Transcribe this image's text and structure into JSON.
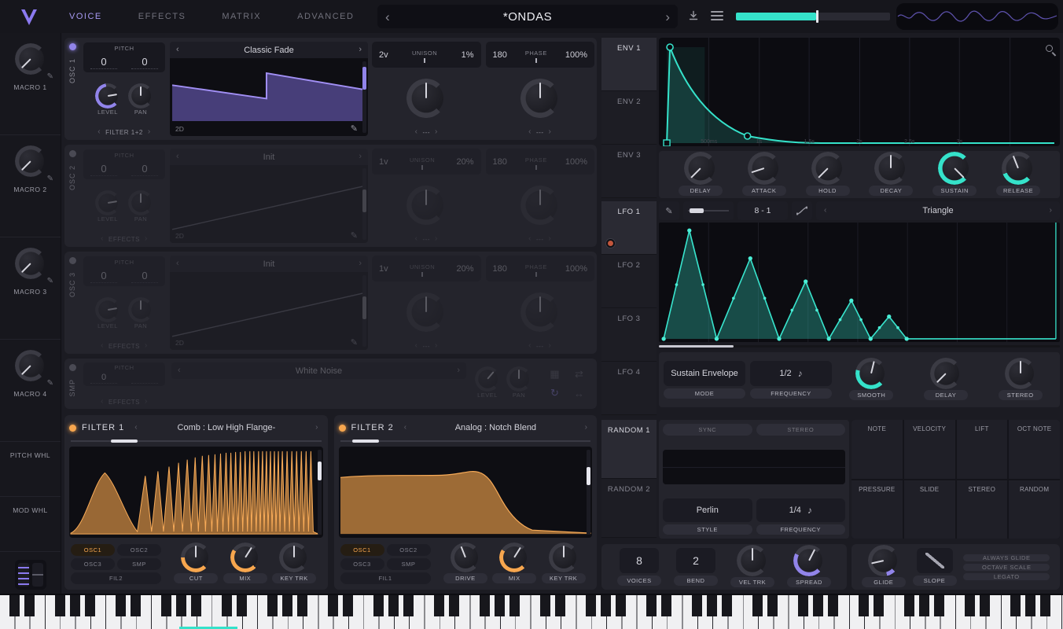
{
  "header": {
    "tabs": [
      "VOICE",
      "EFFECTS",
      "MATRIX",
      "ADVANCED"
    ],
    "preset_name": "*ONDAS"
  },
  "sidebar": {
    "macros": [
      "MACRO 1",
      "MACRO 2",
      "MACRO 3",
      "MACRO 4"
    ],
    "pitch_wheel_label": "PITCH WHL",
    "mod_wheel_label": "MOD WHL"
  },
  "labels": {
    "pitch": "PITCH",
    "level": "LEVEL",
    "pan": "PAN",
    "unison": "UNISON",
    "phase": "PHASE",
    "view_2d": "2D",
    "none_dest": "---"
  },
  "osc1": {
    "name": "OSC 1",
    "transpose": "0",
    "tune": "0",
    "wavetable": "Classic Fade",
    "routing": "FILTER 1+2",
    "unison_voices": "2v",
    "unison_detune": "1%",
    "phase_value": "180",
    "phase_rand": "100%"
  },
  "osc2": {
    "name": "OSC 2",
    "transpose": "0",
    "tune": "0",
    "wavetable": "Init",
    "routing": "EFFECTS",
    "unison_voices": "1v",
    "unison_detune": "20%",
    "phase_value": "180",
    "phase_rand": "100%"
  },
  "osc3": {
    "name": "OSC 3",
    "transpose": "0",
    "tune": "0",
    "wavetable": "Init",
    "routing": "EFFECTS",
    "unison_voices": "1v",
    "unison_detune": "20%",
    "phase_value": "180",
    "phase_rand": "100%"
  },
  "smp": {
    "name": "SMP",
    "transpose": "0",
    "sample": "White Noise",
    "routing": "EFFECTS"
  },
  "filter1": {
    "title": "FILTER 1",
    "model": "Comb : Low High Flange-",
    "inputs": [
      "OSC1",
      "OSC2",
      "OSC3",
      "SMP"
    ],
    "chain": "FIL2",
    "knob_labels": [
      "CUT",
      "MIX",
      "KEY TRK"
    ]
  },
  "filter2": {
    "title": "FILTER 2",
    "model": "Analog : Notch Blend",
    "inputs": [
      "OSC1",
      "OSC2",
      "OSC3",
      "SMP"
    ],
    "chain": "FIL1",
    "knob_labels": [
      "DRIVE",
      "MIX",
      "KEY TRK"
    ]
  },
  "envelope": {
    "tabs": [
      "ENV 1",
      "ENV 2",
      "ENV 3"
    ],
    "knob_labels": [
      "DELAY",
      "ATTACK",
      "HOLD",
      "DECAY",
      "SUSTAIN",
      "RELEASE"
    ],
    "time_labels": [
      "500ms",
      "1s",
      "1.5s",
      "2s",
      "2.5s",
      "3s"
    ]
  },
  "lfo": {
    "tabs": [
      "LFO 1",
      "LFO 2",
      "LFO 3",
      "LFO 4"
    ],
    "steps": "8 - 1",
    "shape": "Triangle",
    "mode_value": "Sustain Envelope",
    "mode_label": "MODE",
    "frequency_value": "1/2",
    "frequency_label": "FREQUENCY",
    "knob_labels": [
      "SMOOTH",
      "DELAY",
      "STEREO"
    ]
  },
  "random": {
    "tabs": [
      "RANDOM 1",
      "RANDOM 2"
    ],
    "sync_label": "SYNC",
    "stereo_label": "STEREO",
    "style_value": "Perlin",
    "style_label": "STYLE",
    "frequency_value": "1/4",
    "frequency_label": "FREQUENCY"
  },
  "mod_sources": [
    "NOTE",
    "VELOCITY",
    "LIFT",
    "OCT NOTE",
    "PRESSURE",
    "SLIDE",
    "STEREO",
    "RANDOM"
  ],
  "voice": {
    "voices_value": "8",
    "voices_label": "VOICES",
    "bend_value": "2",
    "bend_label": "BEND",
    "vel_trk_label": "VEL TRK",
    "spread_label": "SPREAD",
    "glide_label": "GLIDE",
    "slope_label": "SLOPE",
    "toggles": [
      "ALWAYS GLIDE",
      "OCTAVE SCALE",
      "LEGATO"
    ]
  }
}
